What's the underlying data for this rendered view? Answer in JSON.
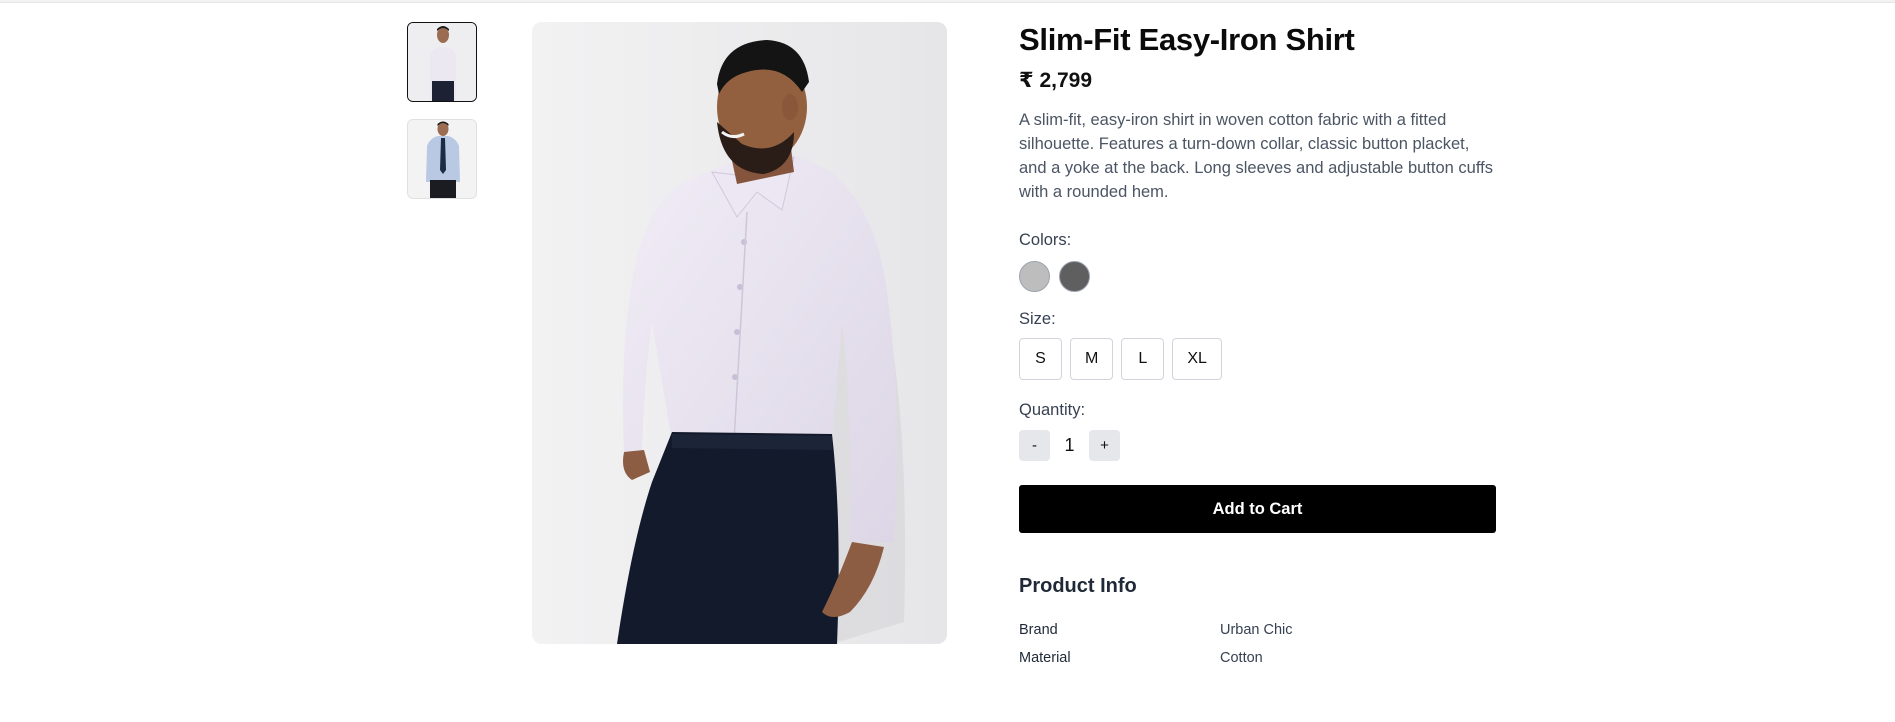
{
  "product": {
    "title": "Slim-Fit Easy-Iron Shirt",
    "price": "₹ 2,799",
    "description": "A slim-fit, easy-iron shirt in woven cotton fabric with a fitted silhouette. Features a turn-down collar, classic button placket, and a yoke at the back. Long sleeves and adjustable button cuffs with a rounded hem."
  },
  "gallery": {
    "thumbnails": [
      {
        "alt": "Front view, light shirt",
        "active": true
      },
      {
        "alt": "Full view with tie",
        "active": false
      }
    ]
  },
  "colors": {
    "label": "Colors:",
    "options": [
      {
        "name": "light-grey",
        "hex": "#bdbdbd"
      },
      {
        "name": "dark-grey",
        "hex": "#5f5f5f"
      }
    ]
  },
  "size": {
    "label": "Size:",
    "options": [
      "S",
      "M",
      "L",
      "XL"
    ]
  },
  "quantity": {
    "label": "Quantity:",
    "decrement": "-",
    "value": "1",
    "increment": "+"
  },
  "actions": {
    "add_to_cart": "Add to Cart"
  },
  "product_info": {
    "title": "Product Info",
    "rows": [
      {
        "key": "Brand",
        "value": "Urban Chic"
      },
      {
        "key": "Material",
        "value": "Cotton"
      }
    ]
  }
}
